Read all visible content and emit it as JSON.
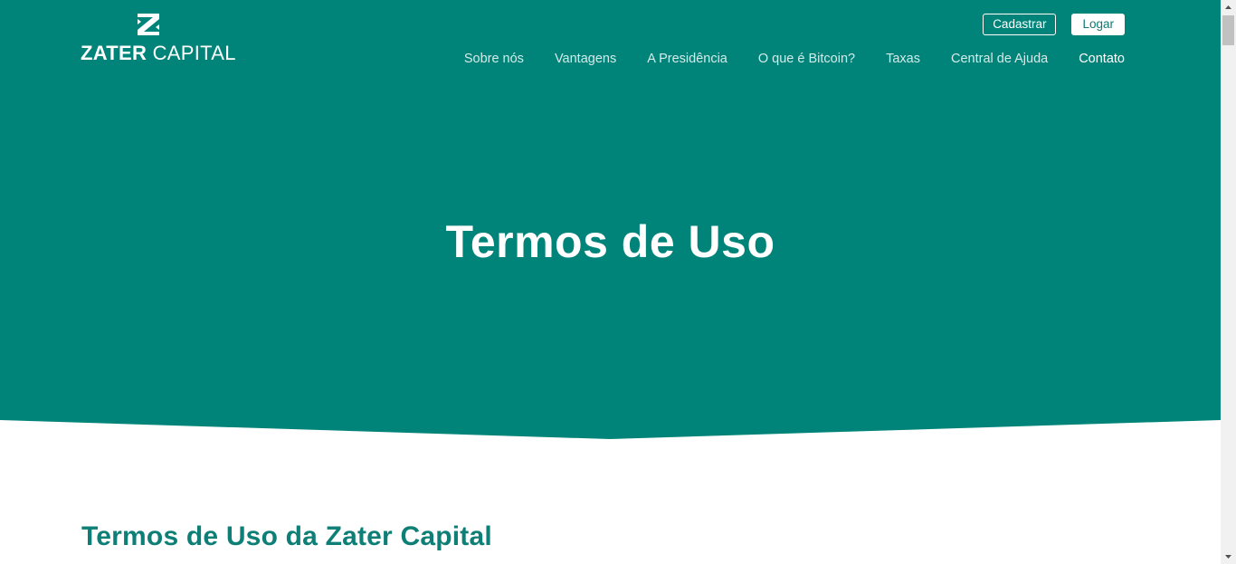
{
  "brand": {
    "name_bold": "ZATER",
    "name_light": " CAPITAL",
    "logo_icon": "z-logo-icon"
  },
  "header": {
    "register_label": "Cadastrar",
    "login_label": "Logar",
    "nav": [
      {
        "label": "Sobre nós"
      },
      {
        "label": "Vantagens"
      },
      {
        "label": "A Presidência"
      },
      {
        "label": "O que é Bitcoin?"
      },
      {
        "label": "Taxas"
      },
      {
        "label": "Central de Ajuda"
      },
      {
        "label": "Contato"
      }
    ]
  },
  "hero": {
    "title": "Termos de Uso"
  },
  "content": {
    "section_title": "Termos de Uso da Zater Capital"
  },
  "colors": {
    "brand_teal": "#00847a",
    "heading_teal": "#0e7f76",
    "white": "#ffffff"
  }
}
